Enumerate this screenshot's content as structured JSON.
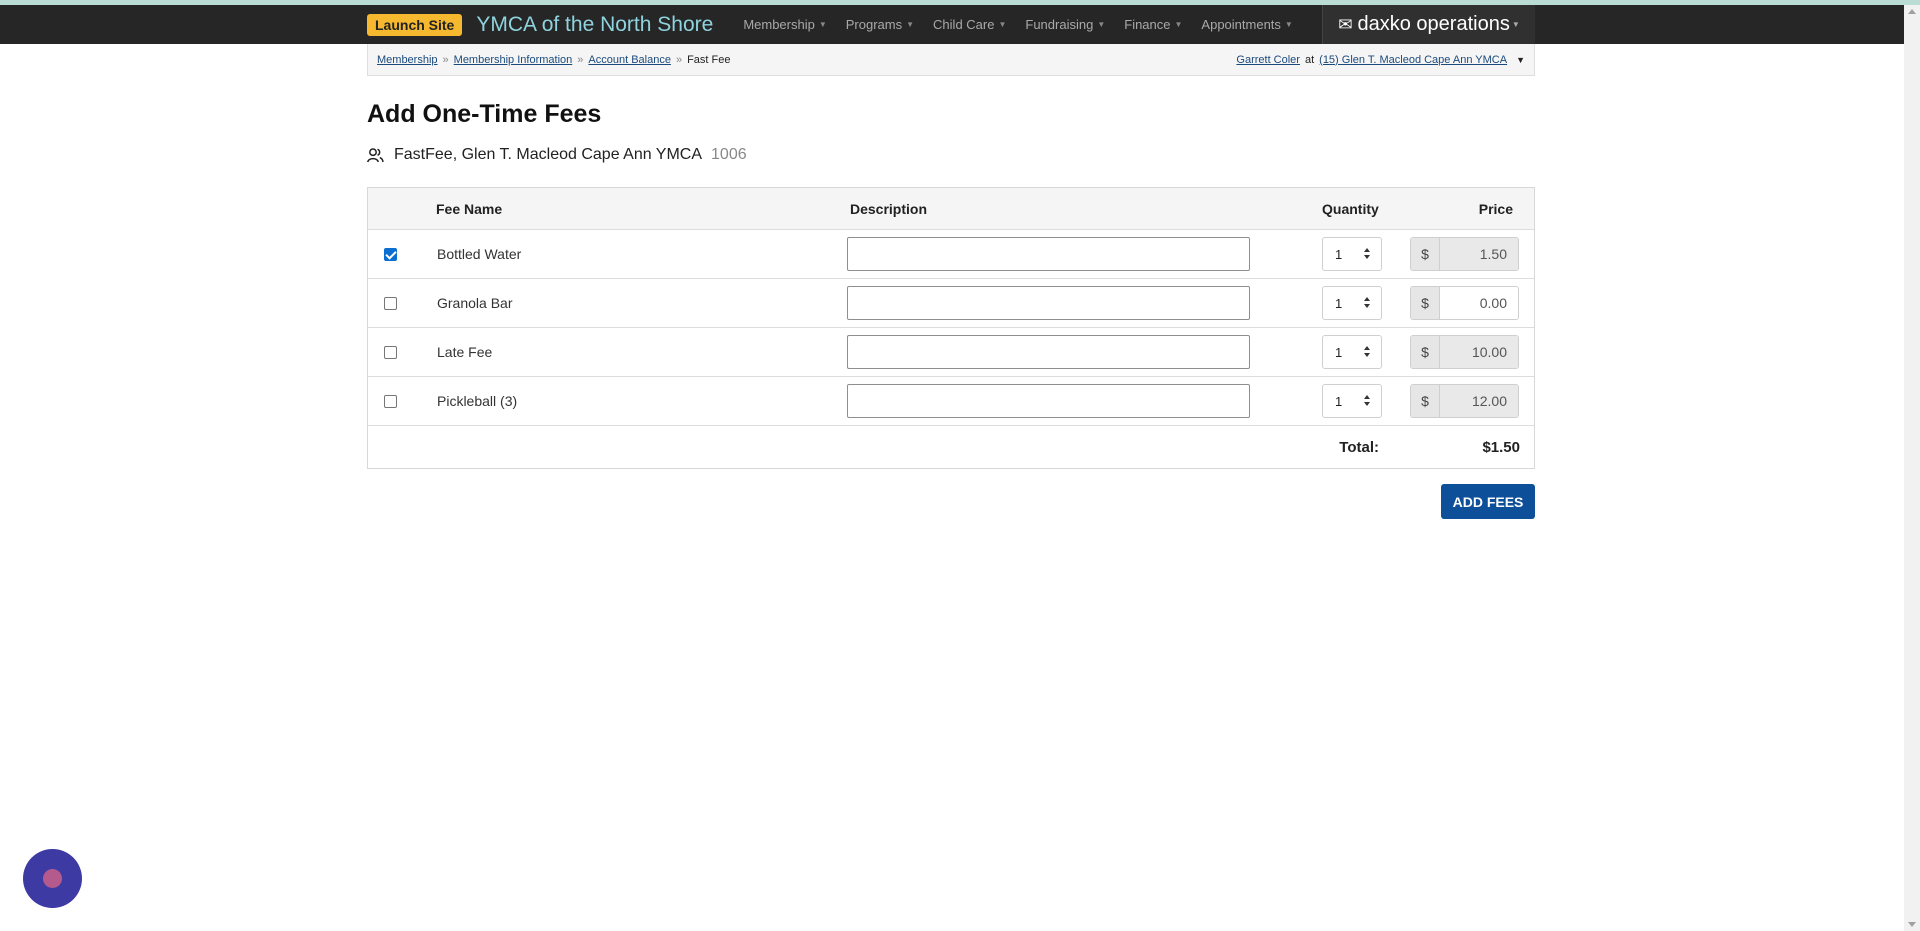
{
  "nav": {
    "launch_label": "Launch Site",
    "site_title": "YMCA of the North Shore",
    "menu": [
      "Membership",
      "Programs",
      "Child Care",
      "Fundraising",
      "Finance",
      "Appointments"
    ],
    "brand": "daxko operations"
  },
  "breadcrumb": {
    "items": [
      "Membership",
      "Membership Information",
      "Account Balance"
    ],
    "current": "Fast Fee",
    "separator": "»",
    "user": "Garrett Coler",
    "at": "at",
    "location": "(15) Glen T. Macleod Cape Ann YMCA"
  },
  "page": {
    "title": "Add One-Time Fees",
    "member_name": "FastFee, Glen T. Macleod Cape Ann YMCA",
    "member_id": "1006"
  },
  "table": {
    "headers": {
      "fee_name": "Fee Name",
      "description": "Description",
      "quantity": "Quantity",
      "price": "Price"
    },
    "currency": "$",
    "rows": [
      {
        "checked": true,
        "name": "Bottled Water",
        "description": "",
        "quantity": "1",
        "price": "1.50",
        "price_editable": false
      },
      {
        "checked": false,
        "name": "Granola Bar",
        "description": "",
        "quantity": "1",
        "price": "0.00",
        "price_editable": true
      },
      {
        "checked": false,
        "name": "Late Fee",
        "description": "",
        "quantity": "1",
        "price": "10.00",
        "price_editable": false
      },
      {
        "checked": false,
        "name": "Pickleball (3)",
        "description": "",
        "quantity": "1",
        "price": "12.00",
        "price_editable": false
      }
    ],
    "total_label": "Total:",
    "total_value": "$1.50"
  },
  "actions": {
    "add_fees": "ADD FEES"
  },
  "colors": {
    "primary": "#0d4f99",
    "launch": "#f5b82e",
    "title_accent": "#8fd3de",
    "nav_bg": "#262626"
  }
}
